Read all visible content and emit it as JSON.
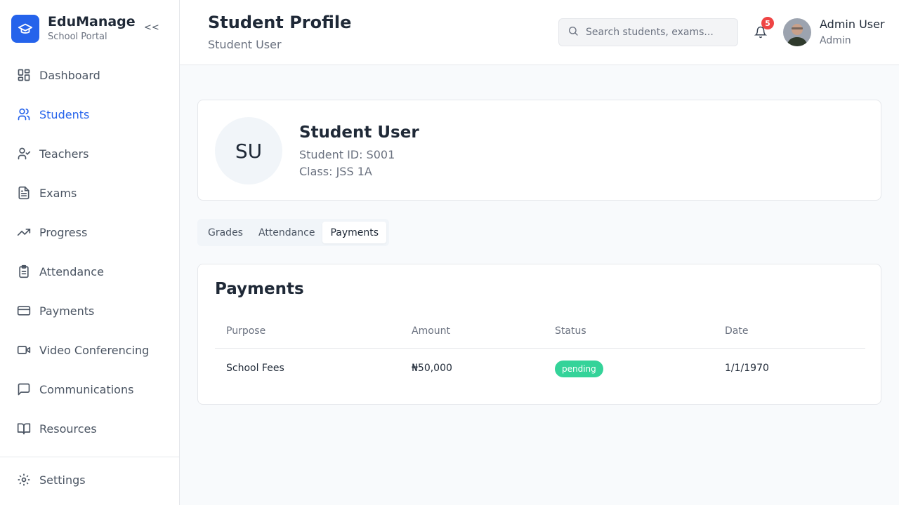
{
  "brand": {
    "title": "EduManage",
    "subtitle": "School Portal",
    "collapse_label": "<<"
  },
  "sidebar": {
    "items": [
      {
        "label": "Dashboard",
        "icon": "dashboard-icon"
      },
      {
        "label": "Students",
        "icon": "users-icon",
        "active": true
      },
      {
        "label": "Teachers",
        "icon": "user-check-icon"
      },
      {
        "label": "Exams",
        "icon": "file-text-icon"
      },
      {
        "label": "Progress",
        "icon": "trending-up-icon"
      },
      {
        "label": "Attendance",
        "icon": "clipboard-icon"
      },
      {
        "label": "Payments",
        "icon": "credit-card-icon"
      },
      {
        "label": "Video Conferencing",
        "icon": "video-icon"
      },
      {
        "label": "Communications",
        "icon": "message-icon"
      },
      {
        "label": "Resources",
        "icon": "book-icon"
      }
    ],
    "settings_label": "Settings"
  },
  "header": {
    "title": "Student Profile",
    "subtitle": "Student User",
    "search_placeholder": "Search students, exams...",
    "notification_count": "5",
    "user_name": "Admin User",
    "user_role": "Admin"
  },
  "profile": {
    "initials": "SU",
    "name": "Student User",
    "student_id": "Student ID: S001",
    "class": "Class: JSS 1A"
  },
  "tabs": [
    {
      "label": "Grades"
    },
    {
      "label": "Attendance"
    },
    {
      "label": "Payments",
      "active": true
    }
  ],
  "payments": {
    "title": "Payments",
    "columns": [
      "Purpose",
      "Amount",
      "Status",
      "Date"
    ],
    "rows": [
      {
        "purpose": "School Fees",
        "amount": "₦50,000",
        "status": "pending",
        "date": "1/1/1970"
      }
    ]
  },
  "colors": {
    "primary": "#2563eb",
    "pending": "#34d399",
    "badge": "#ef4444"
  }
}
